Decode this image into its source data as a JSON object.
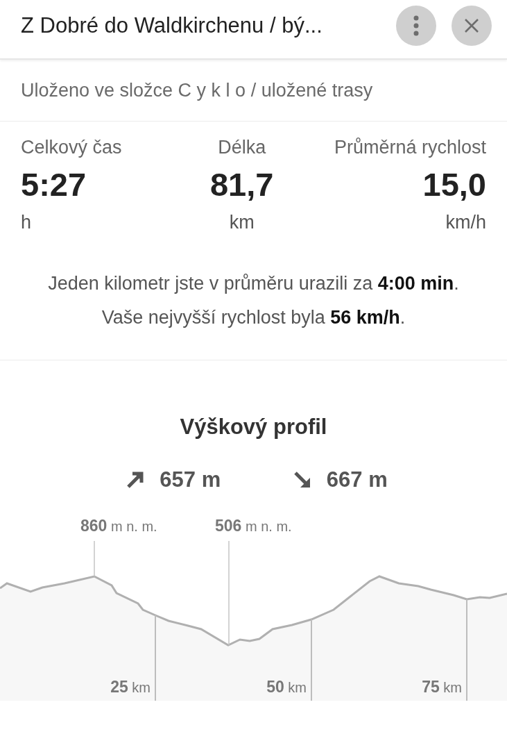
{
  "header": {
    "title": "Z Dobré do Waldkirchenu / bý..."
  },
  "folder_info": "Uloženo ve složce C y k l o / uložené trasy",
  "stats": [
    {
      "label": "Celkový čas",
      "value": "5:27",
      "unit": "h"
    },
    {
      "label": "Délka",
      "value": "81,7",
      "unit": "km"
    },
    {
      "label": "Průměrná rychlost",
      "value": "15,0",
      "unit": "km/h"
    }
  ],
  "summary": [
    "Jeden kilometr jste v průměru urazili za **4:00 min**.",
    "Vaše nejvyšší rychlost byla **56 km/h**."
  ],
  "elevation": {
    "title": "Výškový profil",
    "ascent": "657 m",
    "descent": "667 m",
    "markers": [
      {
        "kind": "max",
        "label": "**860** m n. m."
      },
      {
        "kind": "min",
        "label": "**506** m n. m."
      }
    ],
    "distance_marks": [
      "**25** km",
      "**50** km",
      "**75** km"
    ]
  }
}
